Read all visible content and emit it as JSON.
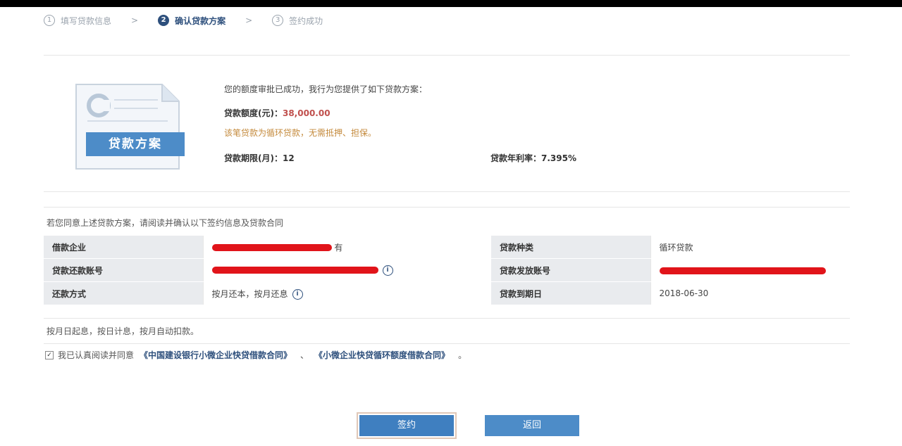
{
  "steps": [
    {
      "num": "1",
      "label": "填写贷款信息"
    },
    {
      "num": "2",
      "label": "确认贷款方案"
    },
    {
      "num": "3",
      "label": "签约成功"
    }
  ],
  "offer": {
    "icon_label": "贷款方案",
    "intro": "您的额度审批已成功，我行为您提供了如下贷款方案：",
    "amount_label": "贷款额度(元)：",
    "amount_value": "38,000.00",
    "note": "该笔贷款为循环贷款，无需抵押、担保。",
    "term_label": "贷款期限(月)：",
    "term_value": "12",
    "rate_label": "贷款年利率：",
    "rate_value": "7.395%"
  },
  "confirm_line": "若您同意上述贷款方案，请阅读并确认以下签约信息及贷款合同",
  "table": {
    "r1": {
      "l1": "借款企业",
      "suffix": "有",
      "l2": "贷款种类",
      "v2": "循环贷款"
    },
    "r2": {
      "l1": "贷款还款账号",
      "l2": "贷款发放账号"
    },
    "r3": {
      "l1": "还款方式",
      "v1": "按月还本，按月还息",
      "l2": "贷款到期日",
      "v2": "2018-06-30"
    }
  },
  "repay_note": "按月日起息，按日计息，按月自动扣款。",
  "agree": {
    "prefix": "我已认真阅读并同意",
    "link1": "《中国建设银行小微企业快贷借款合同》",
    "link2": "《小微企业快贷循环额度借款合同》",
    "end": "。"
  },
  "buttons": {
    "confirm": "签约",
    "back": "返回"
  }
}
